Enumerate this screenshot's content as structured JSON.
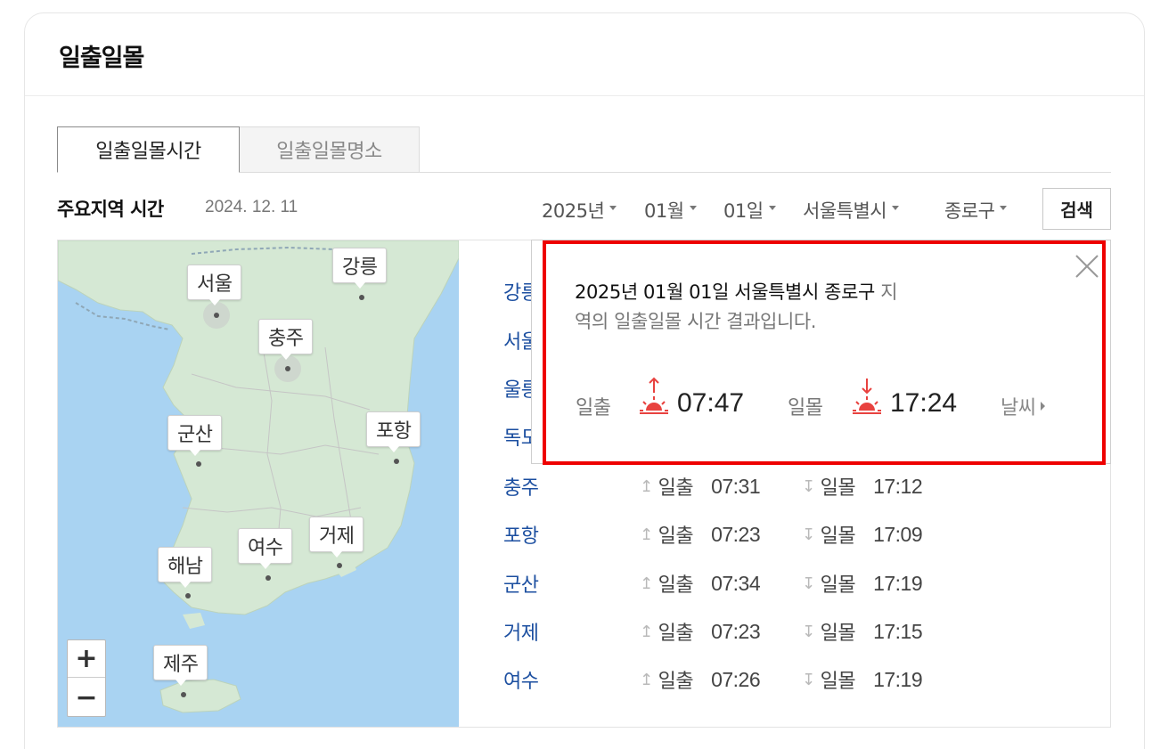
{
  "card": {
    "title": "일출일몰"
  },
  "tabs": [
    {
      "label": "일출일몰시간",
      "active": true
    },
    {
      "label": "일출일몰명소",
      "active": false
    }
  ],
  "section": {
    "title": "주요지역 시간",
    "date": "2024. 12. 11"
  },
  "filters": {
    "year": "2025년",
    "month": "01월",
    "day": "01일",
    "province": "서울특별시",
    "district": "종로구",
    "search_label": "검색"
  },
  "map": {
    "labels": [
      "서울",
      "강릉",
      "충주",
      "군산",
      "포항",
      "여수",
      "거제",
      "해남",
      "제주"
    ],
    "zoom_in": "+",
    "zoom_out": "−",
    "colors": {
      "sea": "#a9d3f2",
      "land": "#d5e8d4"
    }
  },
  "city_list": [
    {
      "name": "강릉"
    },
    {
      "name": "서울"
    },
    {
      "name": "울릉"
    },
    {
      "name": "독도"
    },
    {
      "name": "충주",
      "sunrise": "07:31",
      "sunset": "17:12"
    },
    {
      "name": "포항",
      "sunrise": "07:23",
      "sunset": "17:09"
    },
    {
      "name": "군산",
      "sunrise": "07:34",
      "sunset": "17:19"
    },
    {
      "name": "거제",
      "sunrise": "07:23",
      "sunset": "17:15"
    },
    {
      "name": "여수",
      "sunrise": "07:26",
      "sunset": "17:19"
    }
  ],
  "row_labels": {
    "sunrise": "일출",
    "sunset": "일몰"
  },
  "popup": {
    "text_strong": "2025년 01월 01일 서울특별시 종로구",
    "text_weak_1": " 지",
    "text_weak_2": "역의 일출일몰 시간 결과입니다.",
    "sunrise_label": "일출",
    "sunrise_time": "07:47",
    "sunset_label": "일몰",
    "sunset_time": "17:24",
    "weather_link": "날씨",
    "highlight_color": "#ee0000",
    "sun_color": "#e8423f"
  }
}
